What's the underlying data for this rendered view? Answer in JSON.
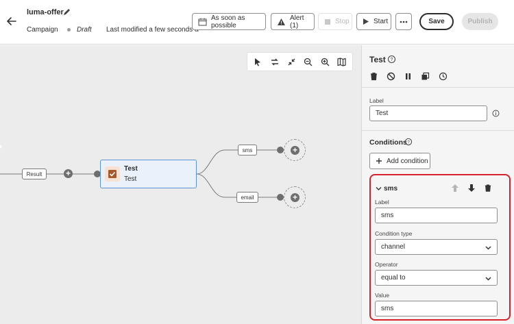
{
  "header": {
    "title": "luma-offer",
    "type_label": "Campaign",
    "status": "Draft",
    "modified": "Last modified a few seconds a",
    "schedule_label": "As soon as possible",
    "alert_label": "Alert (1)",
    "stop_label": "Stop",
    "start_label": "Start",
    "save_label": "Save",
    "publish_label": "Publish"
  },
  "canvas": {
    "result_label": "Result",
    "test_node": {
      "title": "Test",
      "subtitle": "Test"
    },
    "branches": [
      "sms",
      "email"
    ]
  },
  "panel": {
    "title": "Test",
    "label_field": {
      "label": "Label",
      "value": "Test"
    },
    "conditions_title": "Conditions",
    "add_condition_label": "Add condition",
    "condition": {
      "name": "sms",
      "label_field": {
        "label": "Label",
        "value": "sms"
      },
      "type_field": {
        "label": "Condition type",
        "value": "channel"
      },
      "operator_field": {
        "label": "Operator",
        "value": "equal to"
      },
      "value_field": {
        "label": "Value",
        "value": "sms"
      }
    }
  },
  "colors": {
    "accent_blue": "#5a91d6",
    "highlight_red": "#d6202a",
    "node_icon": "#a4582b"
  }
}
